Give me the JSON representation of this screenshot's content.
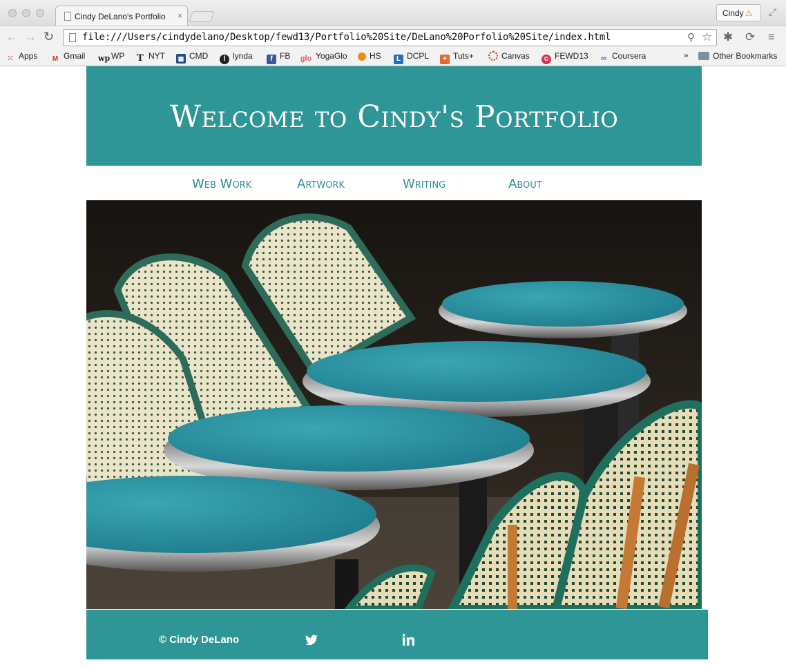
{
  "browser": {
    "tab_title": "Cindy DeLano's Portfolio",
    "tab_close": "×",
    "profile_name": "Cindy",
    "profile_warning": "⚠",
    "url": "file:///Users/cindydelano/Desktop/fewd13/Portfolio%20Site/DeLano%20Porfolio%20Site/index.html",
    "bookmarks": [
      {
        "label": "Apps",
        "icon": "apps-grid-icon"
      },
      {
        "label": "Gmail",
        "icon": "gmail-icon"
      },
      {
        "label": "WP",
        "icon": "washington-post-icon"
      },
      {
        "label": "NYT",
        "icon": "nyt-icon"
      },
      {
        "label": "CMD",
        "icon": "cmd-icon"
      },
      {
        "label": "lynda",
        "icon": "lynda-icon"
      },
      {
        "label": "FB",
        "icon": "facebook-icon"
      },
      {
        "label": "YogaGlo",
        "icon": "yogaglo-icon"
      },
      {
        "label": "HS",
        "icon": "hs-icon"
      },
      {
        "label": "DCPL",
        "icon": "dcpl-icon"
      },
      {
        "label": "Tuts+",
        "icon": "tuts-icon"
      },
      {
        "label": "Canvas",
        "icon": "canvas-icon"
      },
      {
        "label": "FEWD13",
        "icon": "fewd13-icon"
      },
      {
        "label": "Coursera",
        "icon": "coursera-icon"
      }
    ],
    "bookmarks_more": "»",
    "other_bookmarks": "Other Bookmarks"
  },
  "site": {
    "title": "Welcome to Cindy's Portfolio",
    "nav": [
      "Web Work",
      "Artwork",
      "Writing",
      "About"
    ],
    "footer_copyright": "© Cindy DeLano"
  },
  "colors": {
    "brand_teal": "#2e9696",
    "nav_text": "#2e9090"
  }
}
